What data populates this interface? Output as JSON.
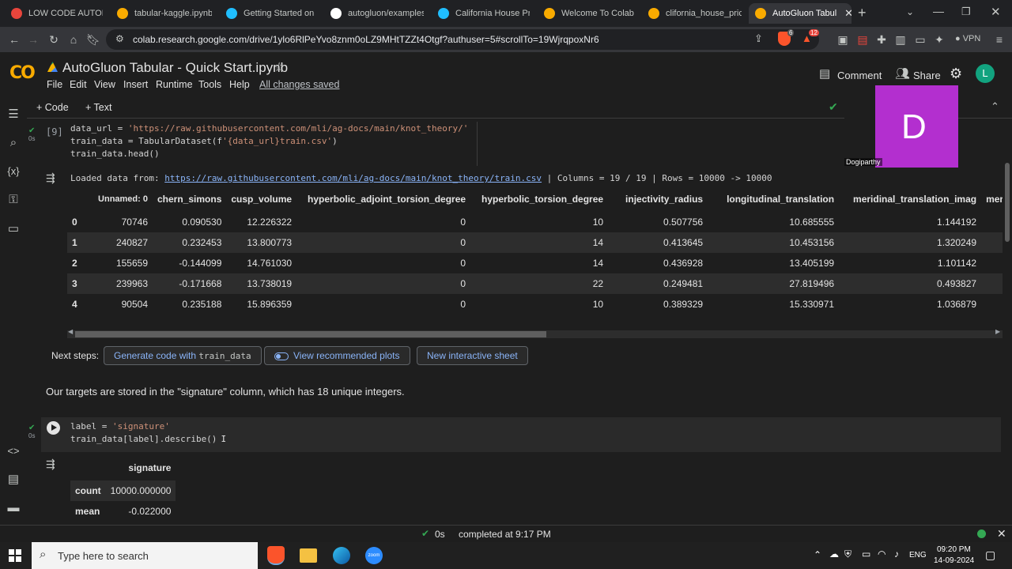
{
  "browser": {
    "tabs": [
      {
        "label": "LOW CODE AUTOMI",
        "icon": "gear-icon",
        "color": "#e8453c"
      },
      {
        "label": "tabular-kaggle.ipynb",
        "icon": "colab-icon",
        "color": "#f9ab00"
      },
      {
        "label": "Getting Started on Ka",
        "icon": "kaggle-icon",
        "color": "#20beff"
      },
      {
        "label": "autogluon/examples",
        "icon": "github-icon",
        "color": "#ffffff"
      },
      {
        "label": "California House Pric",
        "icon": "kaggle-icon",
        "color": "#20beff"
      },
      {
        "label": "Welcome To Colab",
        "icon": "colab-icon",
        "color": "#f9ab00"
      },
      {
        "label": "clifornia_house_price",
        "icon": "colab-icon",
        "color": "#f9ab00"
      },
      {
        "label": "AutoGluon Tabul",
        "icon": "colab-icon",
        "color": "#f9ab00"
      }
    ],
    "url": "colab.research.google.com/drive/1ylo6RlPeYvo8znm0oLZ9MHtTZZt4Otgf?authuser=5#scrollTo=19WjrqpoxNr6",
    "vpn_label": "VPN",
    "brave_badge": "6",
    "alert_badge": "12"
  },
  "colab": {
    "logo": "CO",
    "title": "AutoGluon Tabular - Quick Start.ipynb",
    "menus": [
      "File",
      "Edit",
      "View",
      "Insert",
      "Runtime",
      "Tools",
      "Help"
    ],
    "saved_status": "All changes saved",
    "comment_label": "Comment",
    "share_label": "Share",
    "avatar_letter": "L",
    "add_code": "+ Code",
    "add_text": "+ Text",
    "video_letter": "D",
    "video_name": "Dogiparthy"
  },
  "cell1": {
    "exec_count": "[9]",
    "time": "0s",
    "line1_a": "data_url = ",
    "line1_str": "'https://raw.githubusercontent.com/mli/ag-docs/main/knot_theory/'",
    "line2_a": "train_data = TabularDataset(f",
    "line2_str": "'{data_url}train.csv'",
    "line2_b": ")",
    "line3": "train_data.head()",
    "output_prefix": "Loaded data from: ",
    "output_url": "https://raw.githubusercontent.com/mli/ag-docs/main/knot_theory/train.csv",
    "output_suffix": " | Columns = 19 / 19 | Rows = 10000 -> 10000",
    "table": {
      "headers": [
        "",
        "Unnamed: 0",
        "chern_simons",
        "cusp_volume",
        "hyperbolic_adjoint_torsion_degree",
        "hyperbolic_torsion_degree",
        "injectivity_radius",
        "longitudinal_translation",
        "meridinal_translation_imag",
        "meridina"
      ],
      "rows": [
        [
          "0",
          "70746",
          "0.090530",
          "12.226322",
          "0",
          "10",
          "0.507756",
          "10.685555",
          "1.144192"
        ],
        [
          "1",
          "240827",
          "0.232453",
          "13.800773",
          "0",
          "14",
          "0.413645",
          "10.453156",
          "1.320249"
        ],
        [
          "2",
          "155659",
          "-0.144099",
          "14.761030",
          "0",
          "14",
          "0.436928",
          "13.405199",
          "1.101142"
        ],
        [
          "3",
          "239963",
          "-0.171668",
          "13.738019",
          "0",
          "22",
          "0.249481",
          "27.819496",
          "0.493827"
        ],
        [
          "4",
          "90504",
          "0.235188",
          "15.896359",
          "0",
          "10",
          "0.389329",
          "15.330971",
          "1.036879"
        ]
      ]
    }
  },
  "next_steps": {
    "label": "Next steps:",
    "chip1_a": "Generate code with ",
    "chip1_b": "train_data",
    "chip2": "View recommended plots",
    "chip3": "New interactive sheet"
  },
  "markdown": "Our targets are stored in the \"signature\" column, which has 18 unique integers.",
  "cell2": {
    "time": "0s",
    "line1_a": "label = ",
    "line1_str": "'signature'",
    "line2": "train_data[label].describe()",
    "table": {
      "header": "signature",
      "rows": [
        [
          "count",
          "10000.000000"
        ],
        [
          "mean",
          "-0.022000"
        ]
      ]
    }
  },
  "status": {
    "time": "0s",
    "text": "completed at 9:17 PM"
  },
  "taskbar": {
    "search_placeholder": "Type here to search",
    "lang": "ENG",
    "time": "09:20 PM",
    "date": "14-09-2024"
  }
}
